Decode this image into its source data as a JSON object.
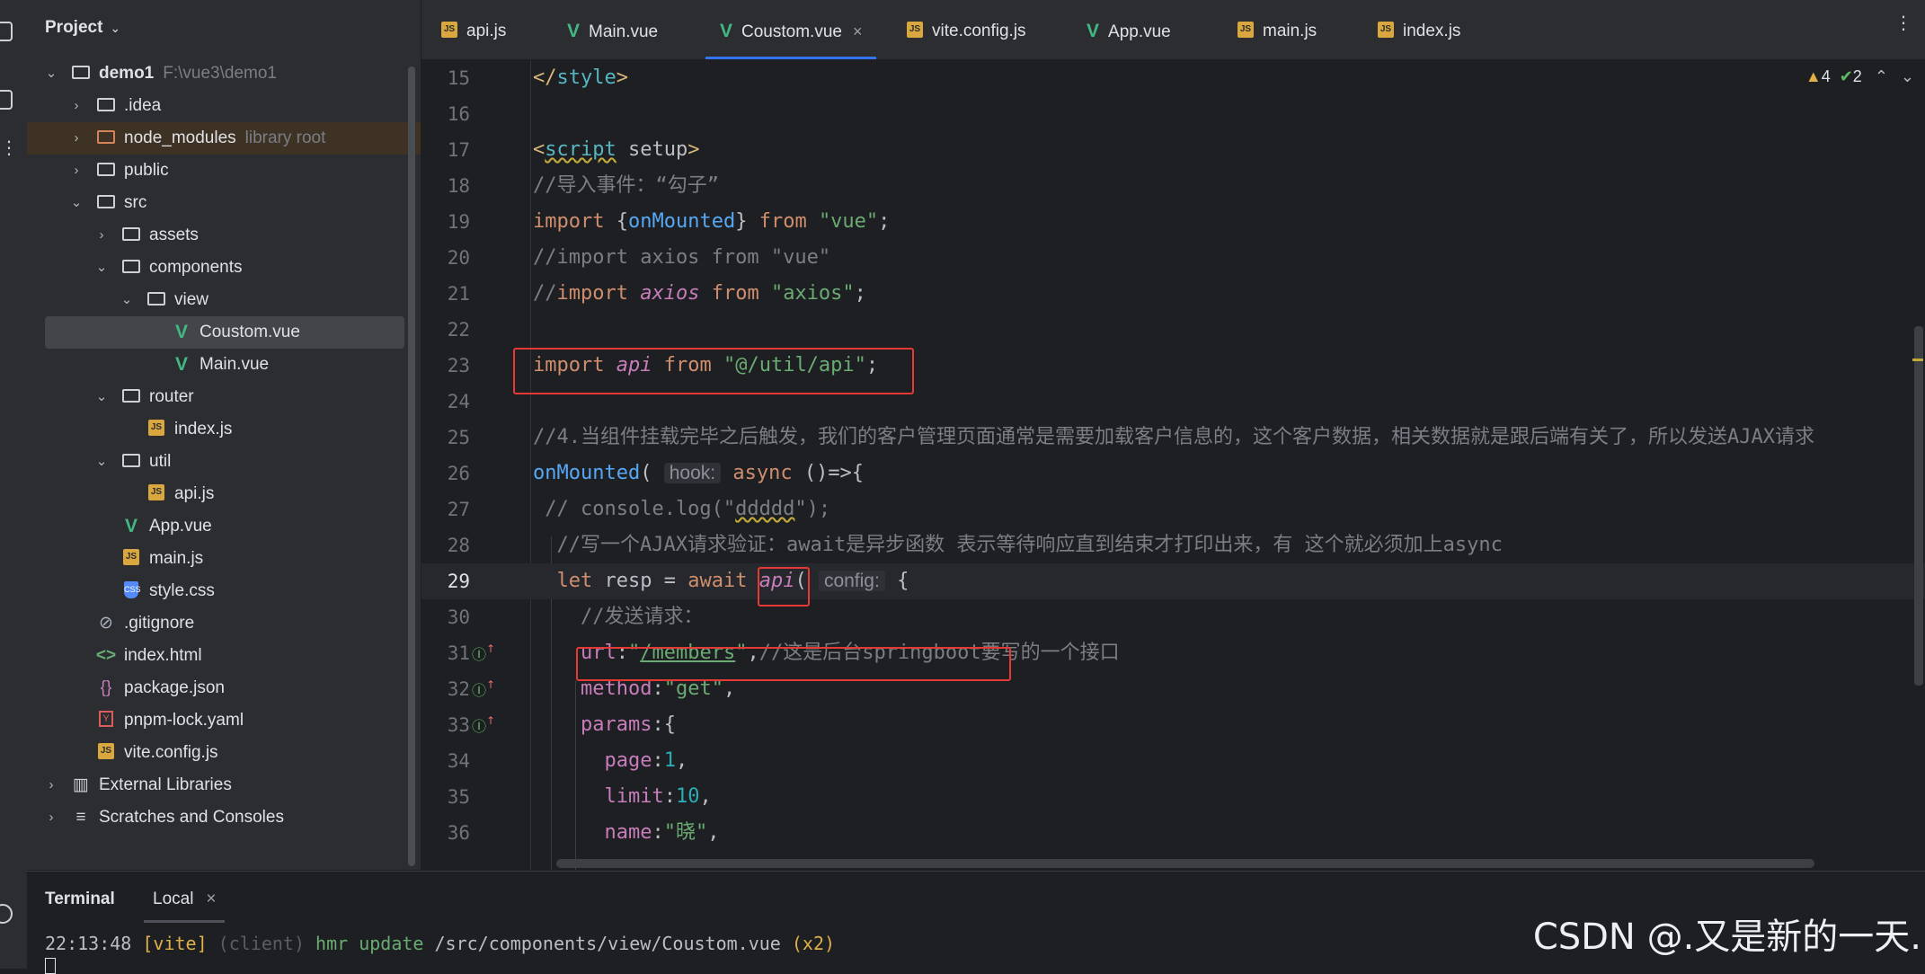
{
  "project": {
    "title": "Project",
    "tree": [
      {
        "label": "demo1",
        "hint": "F:\\vue3\\demo1",
        "icon": "module-folder-icon"
      },
      {
        "label": ".idea",
        "icon": "folder-icon"
      },
      {
        "label": "node_modules",
        "hint": "library root",
        "icon": "folder-icon"
      },
      {
        "label": "public",
        "icon": "folder-icon"
      },
      {
        "label": "src",
        "icon": "folder-icon"
      },
      {
        "label": "assets",
        "icon": "folder-icon"
      },
      {
        "label": "components",
        "icon": "folder-icon"
      },
      {
        "label": "view",
        "icon": "folder-icon"
      },
      {
        "label": "Coustom.vue",
        "icon": "vue-file-icon"
      },
      {
        "label": "Main.vue",
        "icon": "vue-file-icon"
      },
      {
        "label": "router",
        "icon": "folder-icon"
      },
      {
        "label": "index.js",
        "icon": "js-file-icon"
      },
      {
        "label": "util",
        "icon": "folder-icon"
      },
      {
        "label": "api.js",
        "icon": "js-file-icon"
      },
      {
        "label": "App.vue",
        "icon": "vue-file-icon"
      },
      {
        "label": "main.js",
        "icon": "js-file-icon"
      },
      {
        "label": "style.css",
        "icon": "css-file-icon"
      },
      {
        "label": ".gitignore",
        "icon": "ignore-file-icon"
      },
      {
        "label": "index.html",
        "icon": "html-file-icon"
      },
      {
        "label": "package.json",
        "icon": "json-file-icon"
      },
      {
        "label": "pnpm-lock.yaml",
        "icon": "yaml-file-icon"
      },
      {
        "label": "vite.config.js",
        "icon": "js-file-icon"
      },
      {
        "label": "External Libraries",
        "icon": "library-icon"
      },
      {
        "label": "Scratches and Consoles",
        "icon": "scratches-icon"
      }
    ]
  },
  "tabs": [
    {
      "label": "api.js",
      "icon": "js-file-icon"
    },
    {
      "label": "Main.vue",
      "icon": "vue-file-icon"
    },
    {
      "label": "Coustom.vue",
      "icon": "vue-file-icon",
      "active": true
    },
    {
      "label": "vite.config.js",
      "icon": "js-file-icon"
    },
    {
      "label": "App.vue",
      "icon": "vue-file-icon"
    },
    {
      "label": "main.js",
      "icon": "js-file-icon"
    },
    {
      "label": "index.js",
      "icon": "js-file-icon"
    }
  ],
  "inspections": {
    "warnings": "4",
    "ok": "2"
  },
  "editor": {
    "current_line": "29",
    "lines": [
      {
        "n": "15",
        "code": "</style>"
      },
      {
        "n": "16",
        "code": ""
      },
      {
        "n": "17",
        "code": "<script setup>"
      },
      {
        "n": "18",
        "code": "//导入事件：“勾子”"
      },
      {
        "n": "19",
        "code": "import {onMounted} from \"vue\";"
      },
      {
        "n": "20",
        "code": "//import axios from \"vue\""
      },
      {
        "n": "21",
        "code": "//import axios from \"axios\";"
      },
      {
        "n": "22",
        "code": ""
      },
      {
        "n": "23",
        "code": "import api from \"@/util/api\";"
      },
      {
        "n": "24",
        "code": ""
      },
      {
        "n": "25",
        "code": "//4.当组件挂载完毕之后触发，我们的客户管理页面通常是需要加载客户信息的，这个客户数据，相关数据就是跟后端有关了，所以发送AJAX请求"
      },
      {
        "n": "26",
        "code": "onMounted( hook: async ()=>{"
      },
      {
        "n": "27",
        "code": " // console.log(\"ddddd\");"
      },
      {
        "n": "28",
        "code": "  //写一个AJAX请求验证：await是异步函数 表示等待响应直到结束才打印出来，有 这个就必须加上async"
      },
      {
        "n": "29",
        "code": "  let resp = await api( config: {"
      },
      {
        "n": "30",
        "code": "    //发送请求："
      },
      {
        "n": "31",
        "code": "    url:\"/members\",//这是后台springboot要写的一个接口"
      },
      {
        "n": "32",
        "code": "    method:\"get\","
      },
      {
        "n": "33",
        "code": "    params:{"
      },
      {
        "n": "34",
        "code": "      page:1,"
      },
      {
        "n": "35",
        "code": "      limit:10,"
      },
      {
        "n": "36",
        "code": "      name:\"晓\","
      }
    ]
  },
  "terminal": {
    "title": "Terminal",
    "tab": "Local",
    "time": "22:13:48",
    "vite": "[vite]",
    "client": "(client)",
    "hmr": "hmr update",
    "path": "/src/components/view/Coustom.vue",
    "count": "(x2)"
  },
  "watermark": "CSDN @.又是新的一天."
}
